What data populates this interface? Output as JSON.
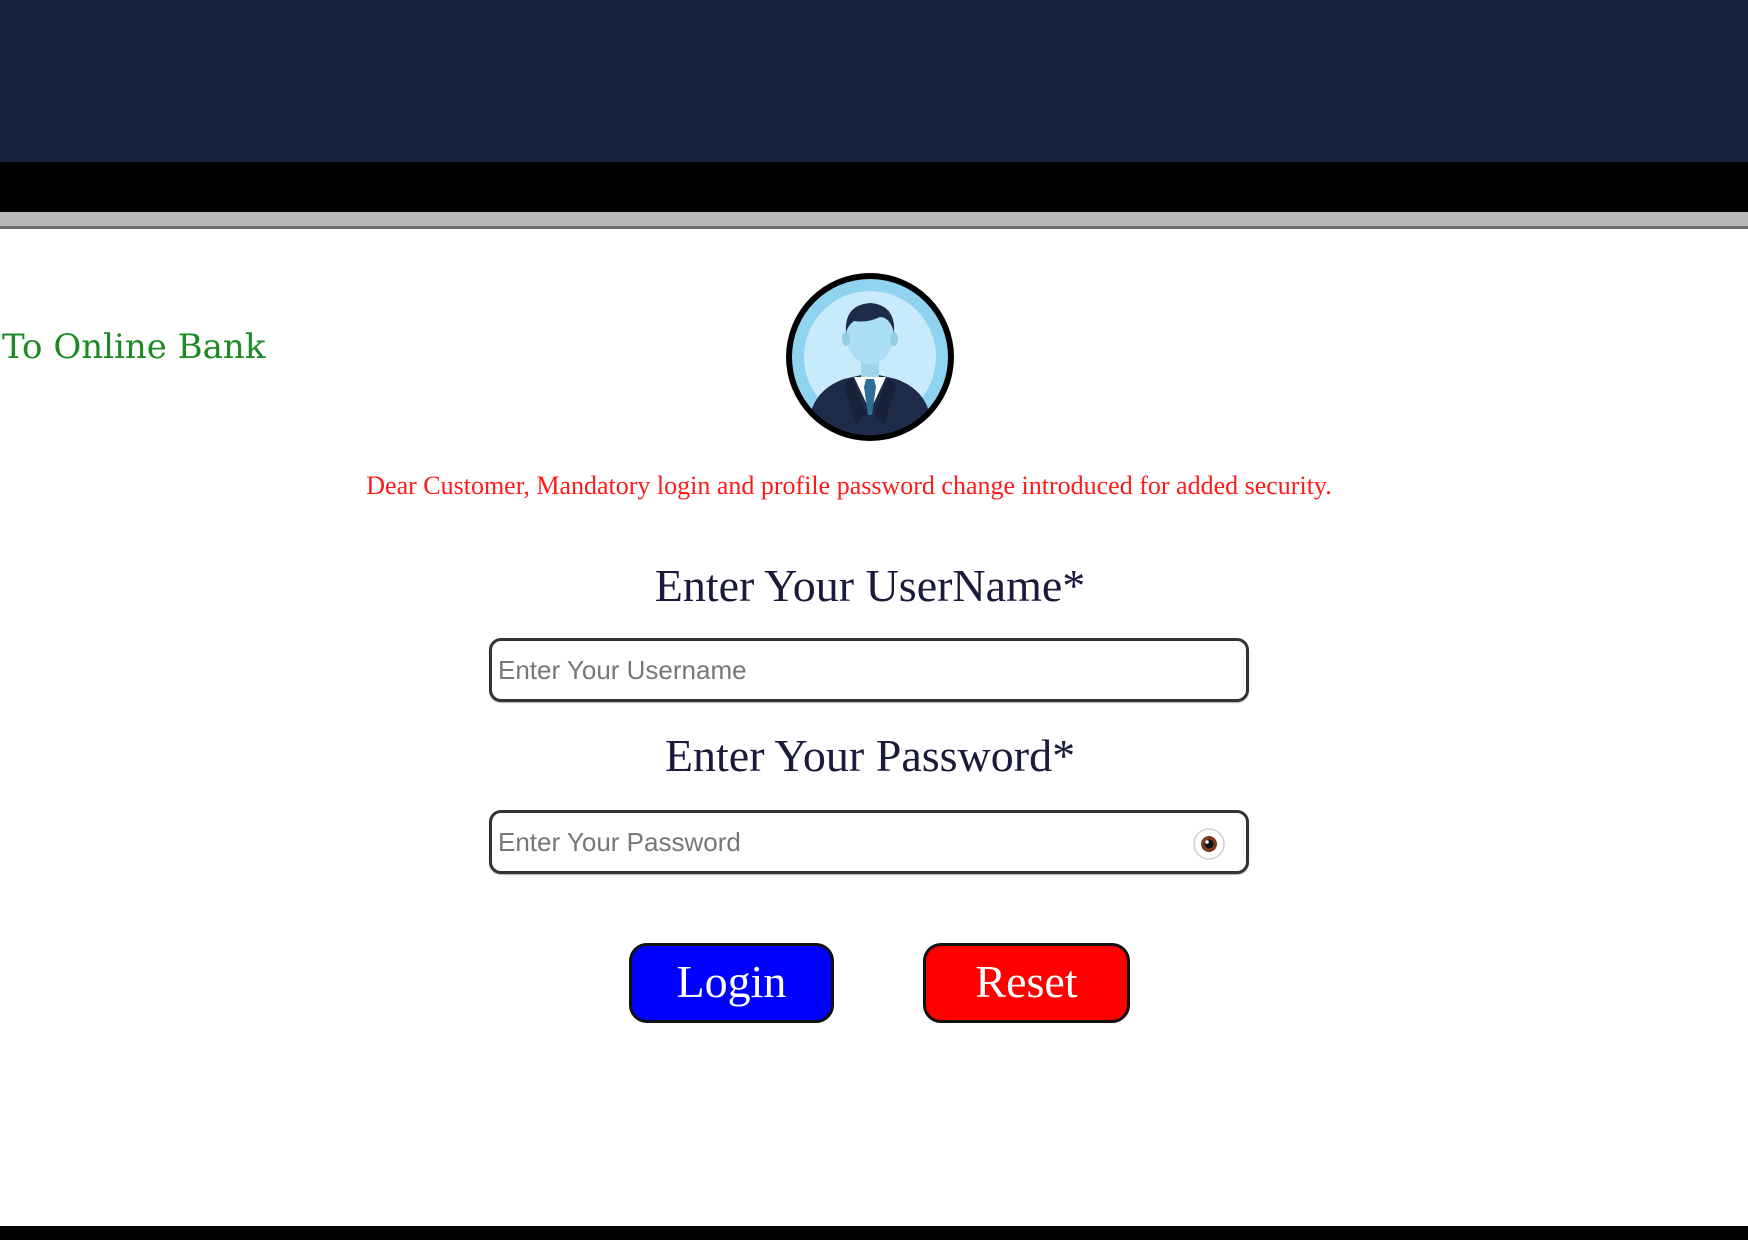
{
  "marquee": {
    "text": "To Online Bank"
  },
  "notice": {
    "text": "Dear Customer, Mandatory login and profile password change introduced for added security."
  },
  "login_form": {
    "username_label": "Enter Your UserName*",
    "username_placeholder": "Enter Your Username",
    "username_value": "",
    "password_label": "Enter Your Password*",
    "password_placeholder": "Enter Your Password",
    "password_value": "",
    "login_label": "Login",
    "reset_label": "Reset"
  },
  "icons": {
    "avatar": "user-avatar-icon",
    "password_toggle": "eye-icon"
  },
  "colors": {
    "header_top": "#19233b",
    "header_black": "#000000",
    "marquee_text": "#1b8a22",
    "notice_text": "#ff1a1a",
    "login_button": "#0000ff",
    "reset_button": "#ff0000"
  }
}
